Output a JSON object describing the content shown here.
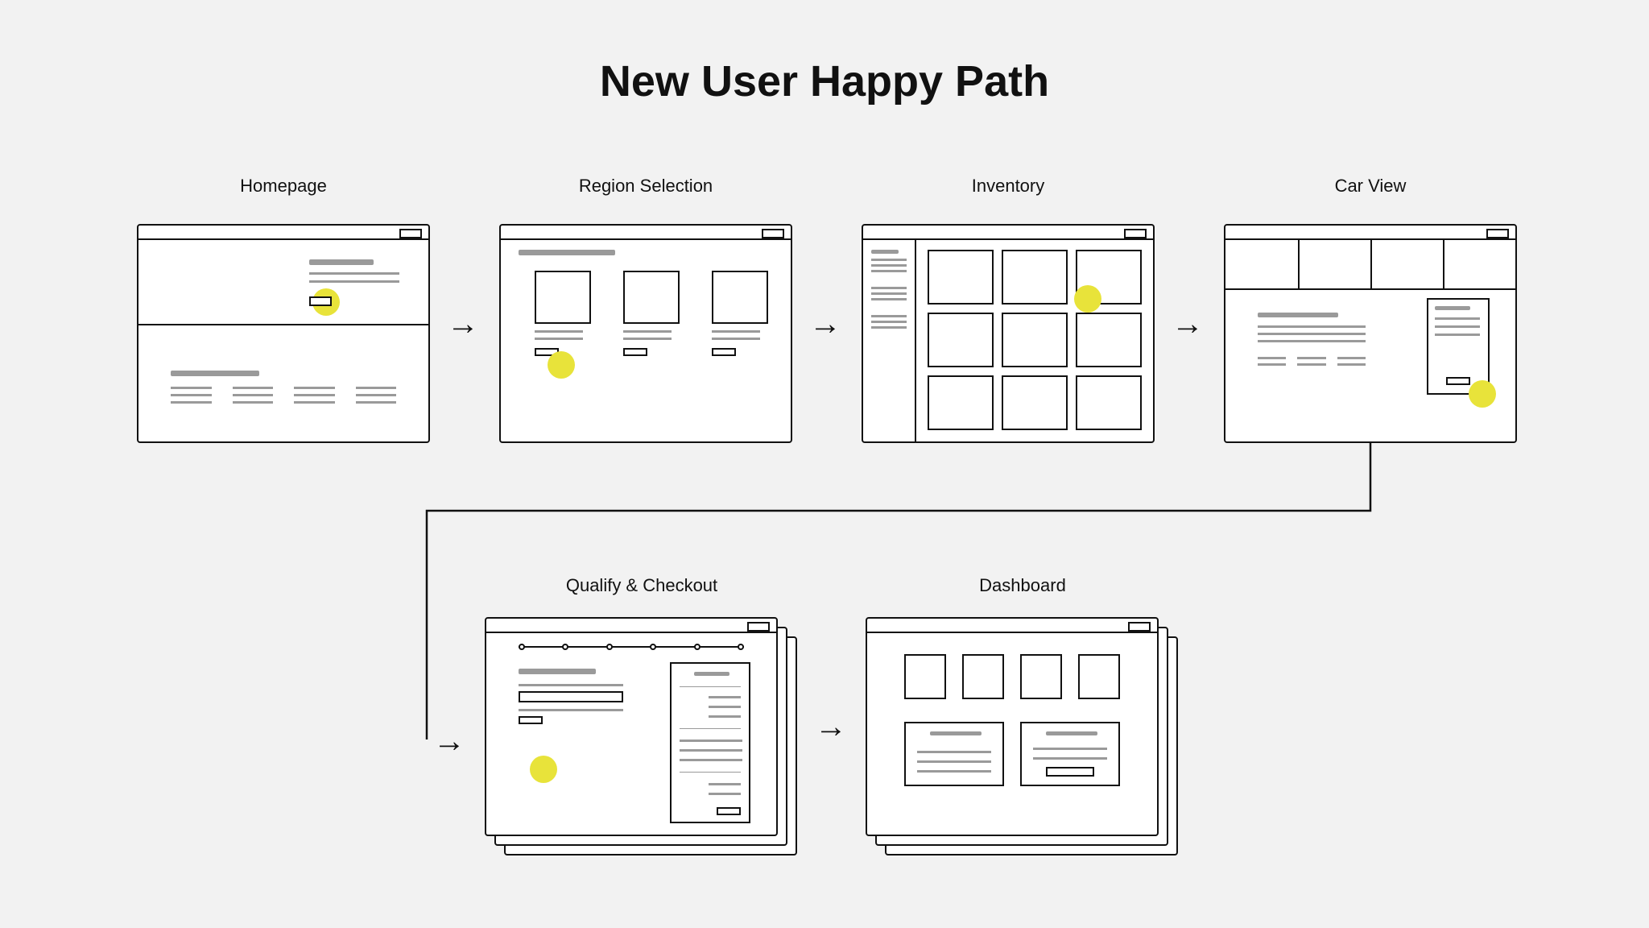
{
  "title": "New User Happy Path",
  "steps": {
    "s1": "Homepage",
    "s2": "Region Selection",
    "s3": "Inventory",
    "s4": "Car View",
    "s5": "Qualify & Checkout",
    "s6": "Dashboard"
  }
}
